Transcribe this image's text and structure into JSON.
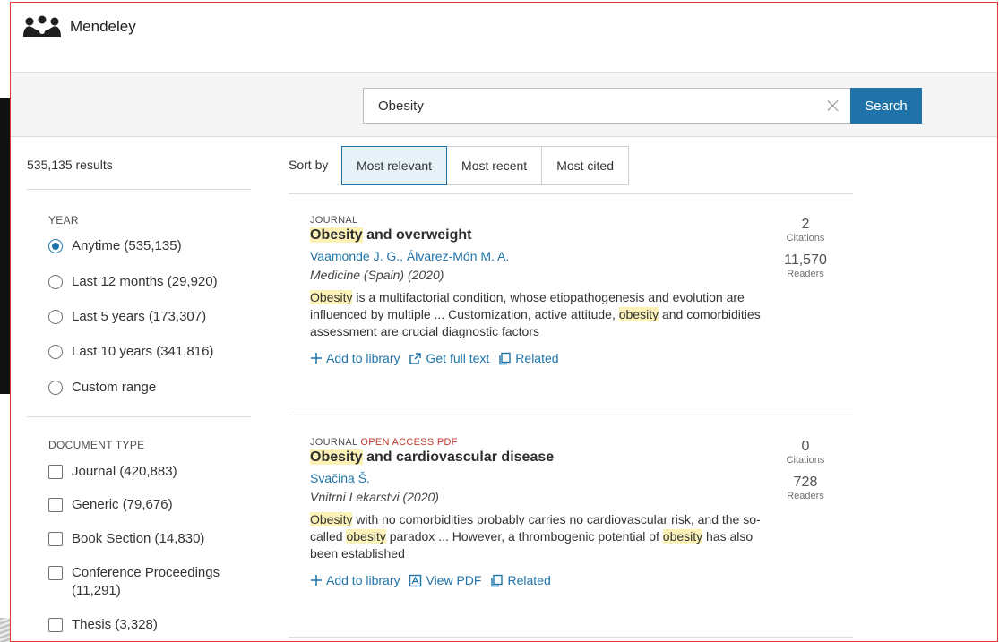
{
  "app": {
    "name": "Mendeley"
  },
  "search": {
    "value": "Obesity",
    "button_label": "Search"
  },
  "results": {
    "count_label": "535,135 results"
  },
  "sort": {
    "label": "Sort by",
    "options": [
      "Most relevant",
      "Most recent",
      "Most cited"
    ],
    "active": "Most relevant"
  },
  "facets": {
    "year": {
      "title": "YEAR",
      "options": [
        {
          "label": "Anytime (535,135)",
          "selected": true
        },
        {
          "label": "Last 12 months (29,920)",
          "selected": false
        },
        {
          "label": "Last 5 years (173,307)",
          "selected": false
        },
        {
          "label": "Last 10 years (341,816)",
          "selected": false
        },
        {
          "label": "Custom range",
          "selected": false
        }
      ]
    },
    "document_type": {
      "title": "DOCUMENT TYPE",
      "options": [
        {
          "label": "Journal (420,883)",
          "checked": false
        },
        {
          "label": "Generic (79,676)",
          "checked": false
        },
        {
          "label": "Book Section (14,830)",
          "checked": false
        },
        {
          "label": "Conference Proceedings (11,291)",
          "checked": false
        },
        {
          "label": "Thesis (3,328)",
          "checked": false
        }
      ]
    }
  },
  "items": [
    {
      "type": "JOURNAL",
      "badges": "",
      "title_hl": "Obesity",
      "title_rest": " and overweight",
      "authors": "Vaamonde J. G., Álvarez-Món M. A.",
      "journal": "Medicine (Spain) (2020)",
      "abstract": [
        {
          "t": "Obesity",
          "hl": true
        },
        {
          "t": " is a multifactorial condition, whose etiopathogenesis and evolution are influenced by multiple ... Customization, active attitude, ",
          "hl": false
        },
        {
          "t": "obesity",
          "hl": true
        },
        {
          "t": " and comorbidities assessment are crucial diagnostic factors",
          "hl": false
        }
      ],
      "citations": "2",
      "citations_label": "Citations",
      "readers": "11,570",
      "readers_label": "Readers",
      "actions": {
        "add": "Add to library",
        "second": "Get full text",
        "related": "Related"
      }
    },
    {
      "type": "JOURNAL",
      "badges": "OPEN ACCESS PDF",
      "title_hl": "Obesity",
      "title_rest": " and cardiovascular disease",
      "authors": "Svačina Š.",
      "journal": "Vnitrni Lekarstvi (2020)",
      "abstract": [
        {
          "t": "Obesity",
          "hl": true
        },
        {
          "t": " with no comorbidities probably carries no cardiovascular risk, and the so-called ",
          "hl": false
        },
        {
          "t": "obesity",
          "hl": true
        },
        {
          "t": " paradox ... However, a thrombogenic potential of ",
          "hl": false
        },
        {
          "t": "obesity",
          "hl": true
        },
        {
          "t": " has also been established",
          "hl": false
        }
      ],
      "citations": "0",
      "citations_label": "Citations",
      "readers": "728",
      "readers_label": "Readers",
      "actions": {
        "add": "Add to library",
        "second": "View PDF",
        "related": "Related"
      }
    }
  ],
  "colors": {
    "accent": "#1f73a8",
    "highlight": "#fcf2b8",
    "open_access": "#c0392b",
    "frame": "#e53935"
  }
}
